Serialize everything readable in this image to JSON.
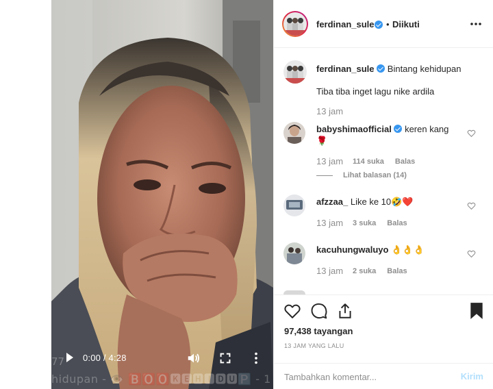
{
  "video": {
    "time": "0:00 / 4:28",
    "overlay_text": "hidupan - 👁️ 🅱️🅾️🅾️🅺️🅴️🅷️🅸️🅳️🆄️🅿️ - 1",
    "overlay_left": "77",
    "icons": [
      "play-icon",
      "volume-icon",
      "fullscreen-icon",
      "more-vertical-icon"
    ]
  },
  "header": {
    "username": "ferdinan_sule",
    "separator": "•",
    "follow_status": "Diikuti",
    "more_icon": "more-horizontal-icon"
  },
  "caption": {
    "username": "ferdinan_sule",
    "line1": "Bintang kehidupan",
    "line2": "Tiba tiba inget lagu nike ardila",
    "time": "13 jam"
  },
  "comments": [
    {
      "username": "babyshimaofficial",
      "verified": true,
      "text": "keren kang",
      "emoji": "🌹",
      "time": "13 jam",
      "likes": "114 suka",
      "reply": "Balas",
      "view_replies": "Lihat balasan (14)"
    },
    {
      "username": "afzzaa_",
      "verified": false,
      "text": "Like ke 10🤣❤️",
      "time": "13 jam",
      "likes": "3 suka",
      "reply": "Balas"
    },
    {
      "username": "kacuhungwaluyo",
      "verified": false,
      "text": "👌👌👌",
      "time": "13 jam",
      "likes": "2 suka",
      "reply": "Balas"
    }
  ],
  "actions": {
    "icons": [
      "heart-icon",
      "comment-icon",
      "share-icon",
      "bookmark-icon"
    ],
    "views": "97,438 tayangan",
    "ago": "13 JAM YANG LALU"
  },
  "add_comment": {
    "placeholder": "Tambahkan komentar...",
    "post_label": "Kirim"
  },
  "colors": {
    "verified": "#3897f0",
    "post_disabled": "#b2dffc",
    "muted": "#8e8e8e",
    "text": "#262626"
  }
}
